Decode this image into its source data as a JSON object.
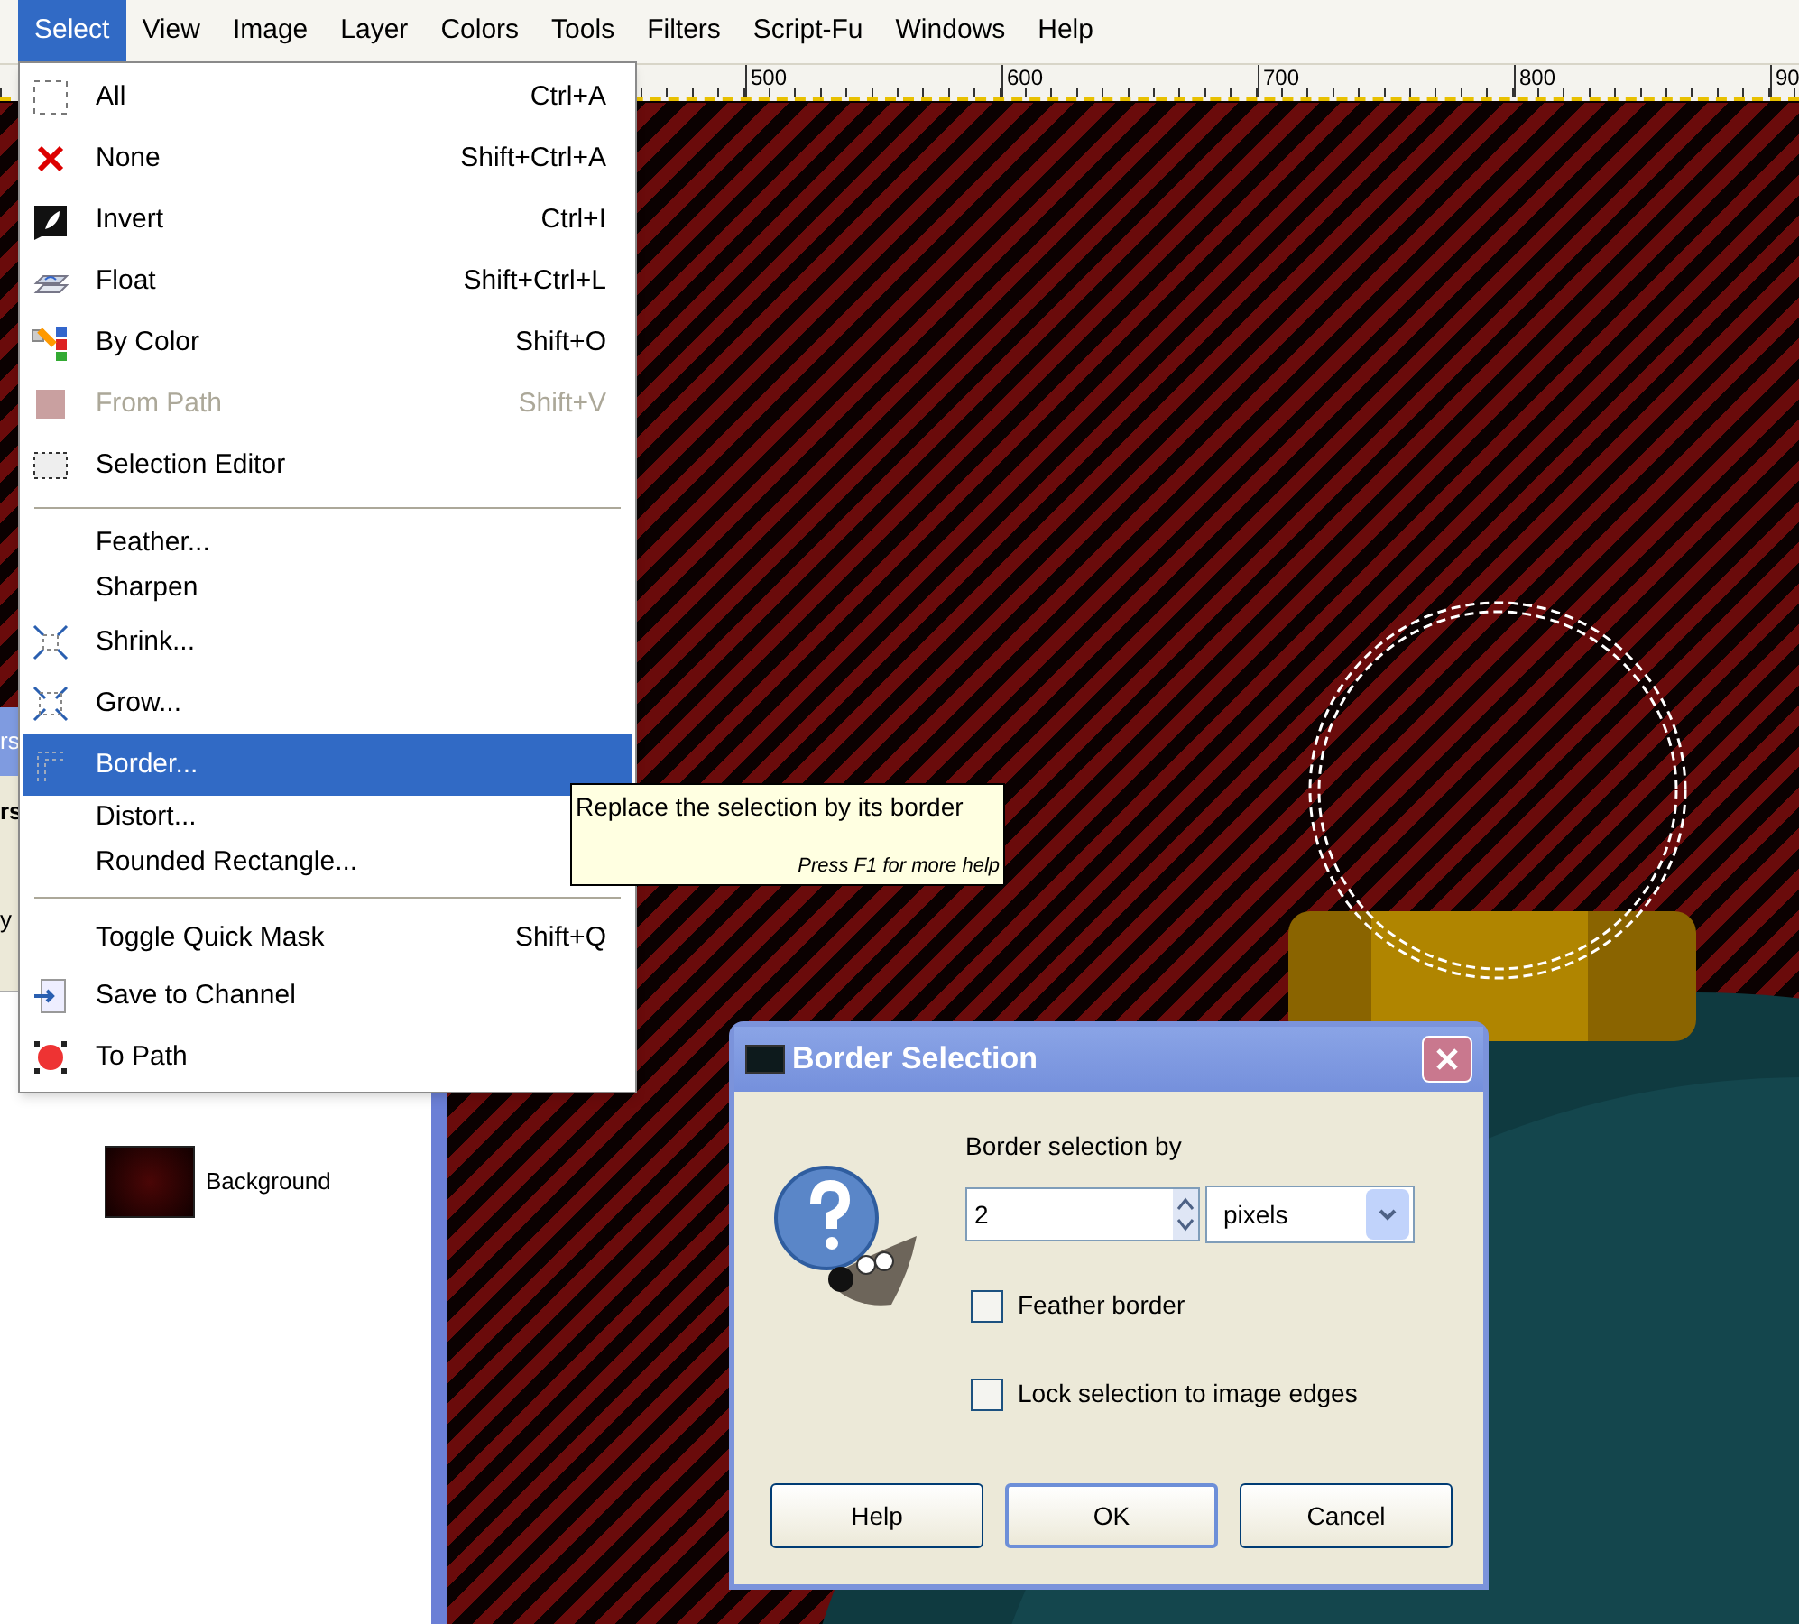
{
  "menubar": [
    {
      "label": "Select",
      "selected": true
    },
    {
      "label": "View",
      "selected": false
    },
    {
      "label": "Image",
      "selected": false
    },
    {
      "label": "Layer",
      "selected": false
    },
    {
      "label": "Colors",
      "selected": false
    },
    {
      "label": "Tools",
      "selected": false
    },
    {
      "label": "Filters",
      "selected": false
    },
    {
      "label": "Script-Fu",
      "selected": false
    },
    {
      "label": "Windows",
      "selected": false
    },
    {
      "label": "Help",
      "selected": false
    }
  ],
  "ruler": {
    "labels": [
      "500",
      "600",
      "700",
      "800",
      "90"
    ]
  },
  "dock": {
    "title": "rs",
    "labels": [
      "rs",
      "y"
    ],
    "layers": [
      {
        "name": "Background"
      }
    ]
  },
  "menu": {
    "items": [
      {
        "kind": "item",
        "label": "All",
        "shortcut": "Ctrl+A",
        "disabled": false,
        "selected": false
      },
      {
        "kind": "item",
        "label": "None",
        "shortcut": "Shift+Ctrl+A",
        "disabled": false,
        "selected": false
      },
      {
        "kind": "item",
        "label": "Invert",
        "shortcut": "Ctrl+I",
        "disabled": false,
        "selected": false
      },
      {
        "kind": "item",
        "label": "Float",
        "shortcut": "Shift+Ctrl+L",
        "disabled": false,
        "selected": false
      },
      {
        "kind": "item",
        "label": "By Color",
        "shortcut": "Shift+O",
        "disabled": false,
        "selected": false
      },
      {
        "kind": "item",
        "label": "From Path",
        "shortcut": "Shift+V",
        "disabled": true,
        "selected": false
      },
      {
        "kind": "item",
        "label": "Selection Editor",
        "disabled": false,
        "selected": false
      },
      {
        "kind": "separator"
      },
      {
        "kind": "item",
        "label": "Feather...",
        "disabled": false,
        "selected": false
      },
      {
        "kind": "item",
        "label": "Sharpen",
        "disabled": false,
        "selected": false
      },
      {
        "kind": "item",
        "label": "Shrink...",
        "disabled": false,
        "selected": false
      },
      {
        "kind": "item",
        "label": "Grow...",
        "disabled": false,
        "selected": false
      },
      {
        "kind": "item",
        "label": "Border...",
        "disabled": false,
        "selected": true
      },
      {
        "kind": "item",
        "label": "Distort...",
        "disabled": false,
        "selected": false
      },
      {
        "kind": "item",
        "label": "Rounded Rectangle...",
        "disabled": false,
        "selected": false
      },
      {
        "kind": "separator"
      },
      {
        "kind": "item",
        "label": "Toggle Quick Mask",
        "shortcut": "Shift+Q",
        "disabled": false,
        "selected": false
      },
      {
        "kind": "item",
        "label": "Save to Channel",
        "disabled": false,
        "selected": false
      },
      {
        "kind": "item",
        "label": "To Path",
        "disabled": false,
        "selected": false
      }
    ]
  },
  "tooltip": {
    "text": "Replace the selection by its border",
    "hint": "Press F1 for more help"
  },
  "dialog": {
    "title": "Border Selection",
    "prompt": "Border selection by",
    "value": "2",
    "unit": "pixels",
    "checkboxes": [
      {
        "label": "Feather border",
        "checked": false
      },
      {
        "label": "Lock selection to image edges",
        "checked": false
      }
    ],
    "buttons": [
      {
        "label": "Help",
        "default": false
      },
      {
        "label": "OK",
        "default": true
      },
      {
        "label": "Cancel",
        "default": false
      }
    ]
  }
}
